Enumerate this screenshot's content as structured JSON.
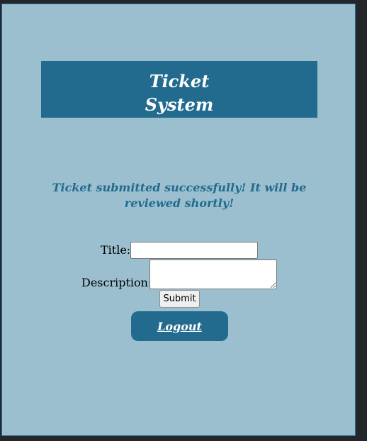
{
  "header": {
    "title": "Ticket System"
  },
  "message": {
    "success": "Ticket submitted successfully! It will be reviewed shortly!"
  },
  "form": {
    "title_label": "Title:",
    "title_value": "",
    "description_label": "Description:",
    "description_value": "",
    "submit_label": "Submit"
  },
  "nav": {
    "logout_label": "Logout"
  },
  "colors": {
    "page_background": "#9bbfcf",
    "accent": "#226b8f",
    "outer_background": "#24262a"
  }
}
